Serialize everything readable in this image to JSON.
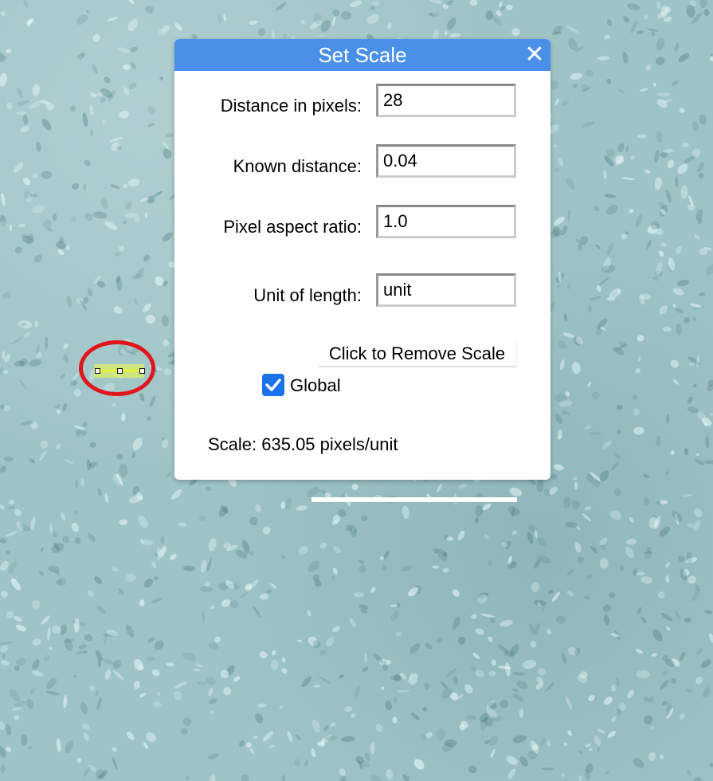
{
  "dialog": {
    "title": "Set Scale",
    "close_icon": "close-icon",
    "fields": [
      {
        "label": "Distance in pixels:",
        "value": "28"
      },
      {
        "label": "Known distance:",
        "value": "0.04"
      },
      {
        "label": "Pixel aspect ratio:",
        "value": "1.0"
      },
      {
        "label": "Unit of length:",
        "value": "unit"
      }
    ],
    "remove_button": "Click to Remove Scale",
    "global": {
      "label": "Global",
      "checked": true
    },
    "scale_text": "Scale: 635.05 pixels/unit"
  },
  "colors": {
    "titlebar": "#4a90e8",
    "checkbox": "#1a73e8",
    "selection_circle": "#e0161c",
    "selection_line": "#f2f21a"
  }
}
